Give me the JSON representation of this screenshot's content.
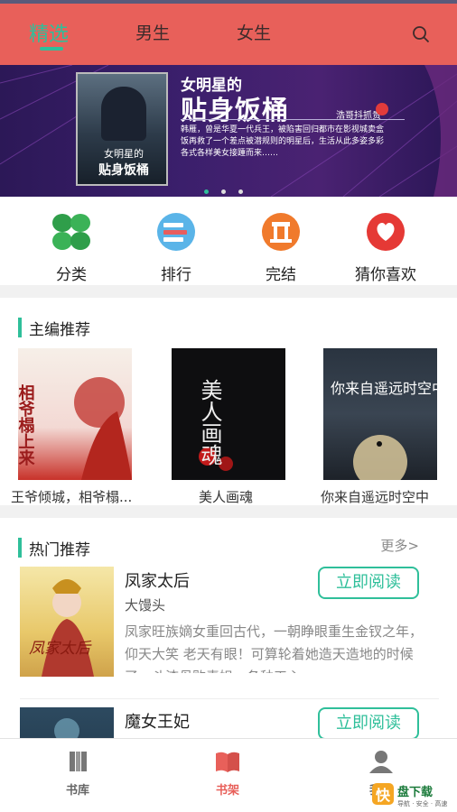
{
  "top_tabs": [
    {
      "label": "精选",
      "active": true
    },
    {
      "label": "男生",
      "active": false
    },
    {
      "label": "女生",
      "active": false
    }
  ],
  "search_icon": "search-icon",
  "banner": {
    "cover_caption": "女明星的",
    "cover_caption2": "贴身饭桶",
    "title_line1": "女明星的",
    "title_line2": "贴身饭桶",
    "author": "浩哥抖抓贵",
    "description": "韩雁，曾是华夏一代兵王，被陷害回归都市在影视城卖盒饭再救了一个差点被潜规则的明星后，生活从此多姿多彩各式各样美女接踵而来……",
    "dots": 3,
    "active_dot": 0
  },
  "categories": [
    {
      "label": "分类",
      "icon": "clover-icon",
      "color": "#2f9e4a"
    },
    {
      "label": "排行",
      "icon": "ranking-icon",
      "color": "#4aa7e0"
    },
    {
      "label": "完结",
      "icon": "finished-icon",
      "color": "#f07a2c"
    },
    {
      "label": "猜你喜欢",
      "icon": "heart-icon",
      "color": "#e53935"
    }
  ],
  "editor_picks": {
    "title": "主编推荐",
    "books": [
      {
        "title": "王爷倾城，相爷榻...",
        "cover_text": "相爷榻上来"
      },
      {
        "title": "美人画魂",
        "cover_text": "美人画魂"
      },
      {
        "title": "你来自遥远时空中",
        "cover_text": "你来自遥远时空中"
      }
    ]
  },
  "hot": {
    "title": "热门推荐",
    "more": "更多>",
    "books": [
      {
        "name": "凤家太后",
        "author": "大馒头",
        "desc": "凤家旺族嫡女重回古代，一朝睁眼重生金钗之年，仰天大笑 老天有眼！可算轮着她造天造地的时候了，斗渣母败毒姐，各种工心",
        "button": "立即阅读"
      },
      {
        "name": "魔女王妃",
        "author": "",
        "desc": "",
        "button": "立即阅读"
      }
    ]
  },
  "bottom_nav": [
    {
      "label": "书库",
      "icon": "library-icon",
      "active": false
    },
    {
      "label": "书架",
      "icon": "bookshelf-icon",
      "active": true
    },
    {
      "label": "我的",
      "icon": "profile-icon",
      "active": false
    }
  ],
  "watermark": {
    "brand": "快盘下载",
    "tagline": "导航 · 安全 · 高速"
  },
  "colors": {
    "accent": "#2fbf9a",
    "header": "#e8605a",
    "active_nav": "#e8605a"
  }
}
